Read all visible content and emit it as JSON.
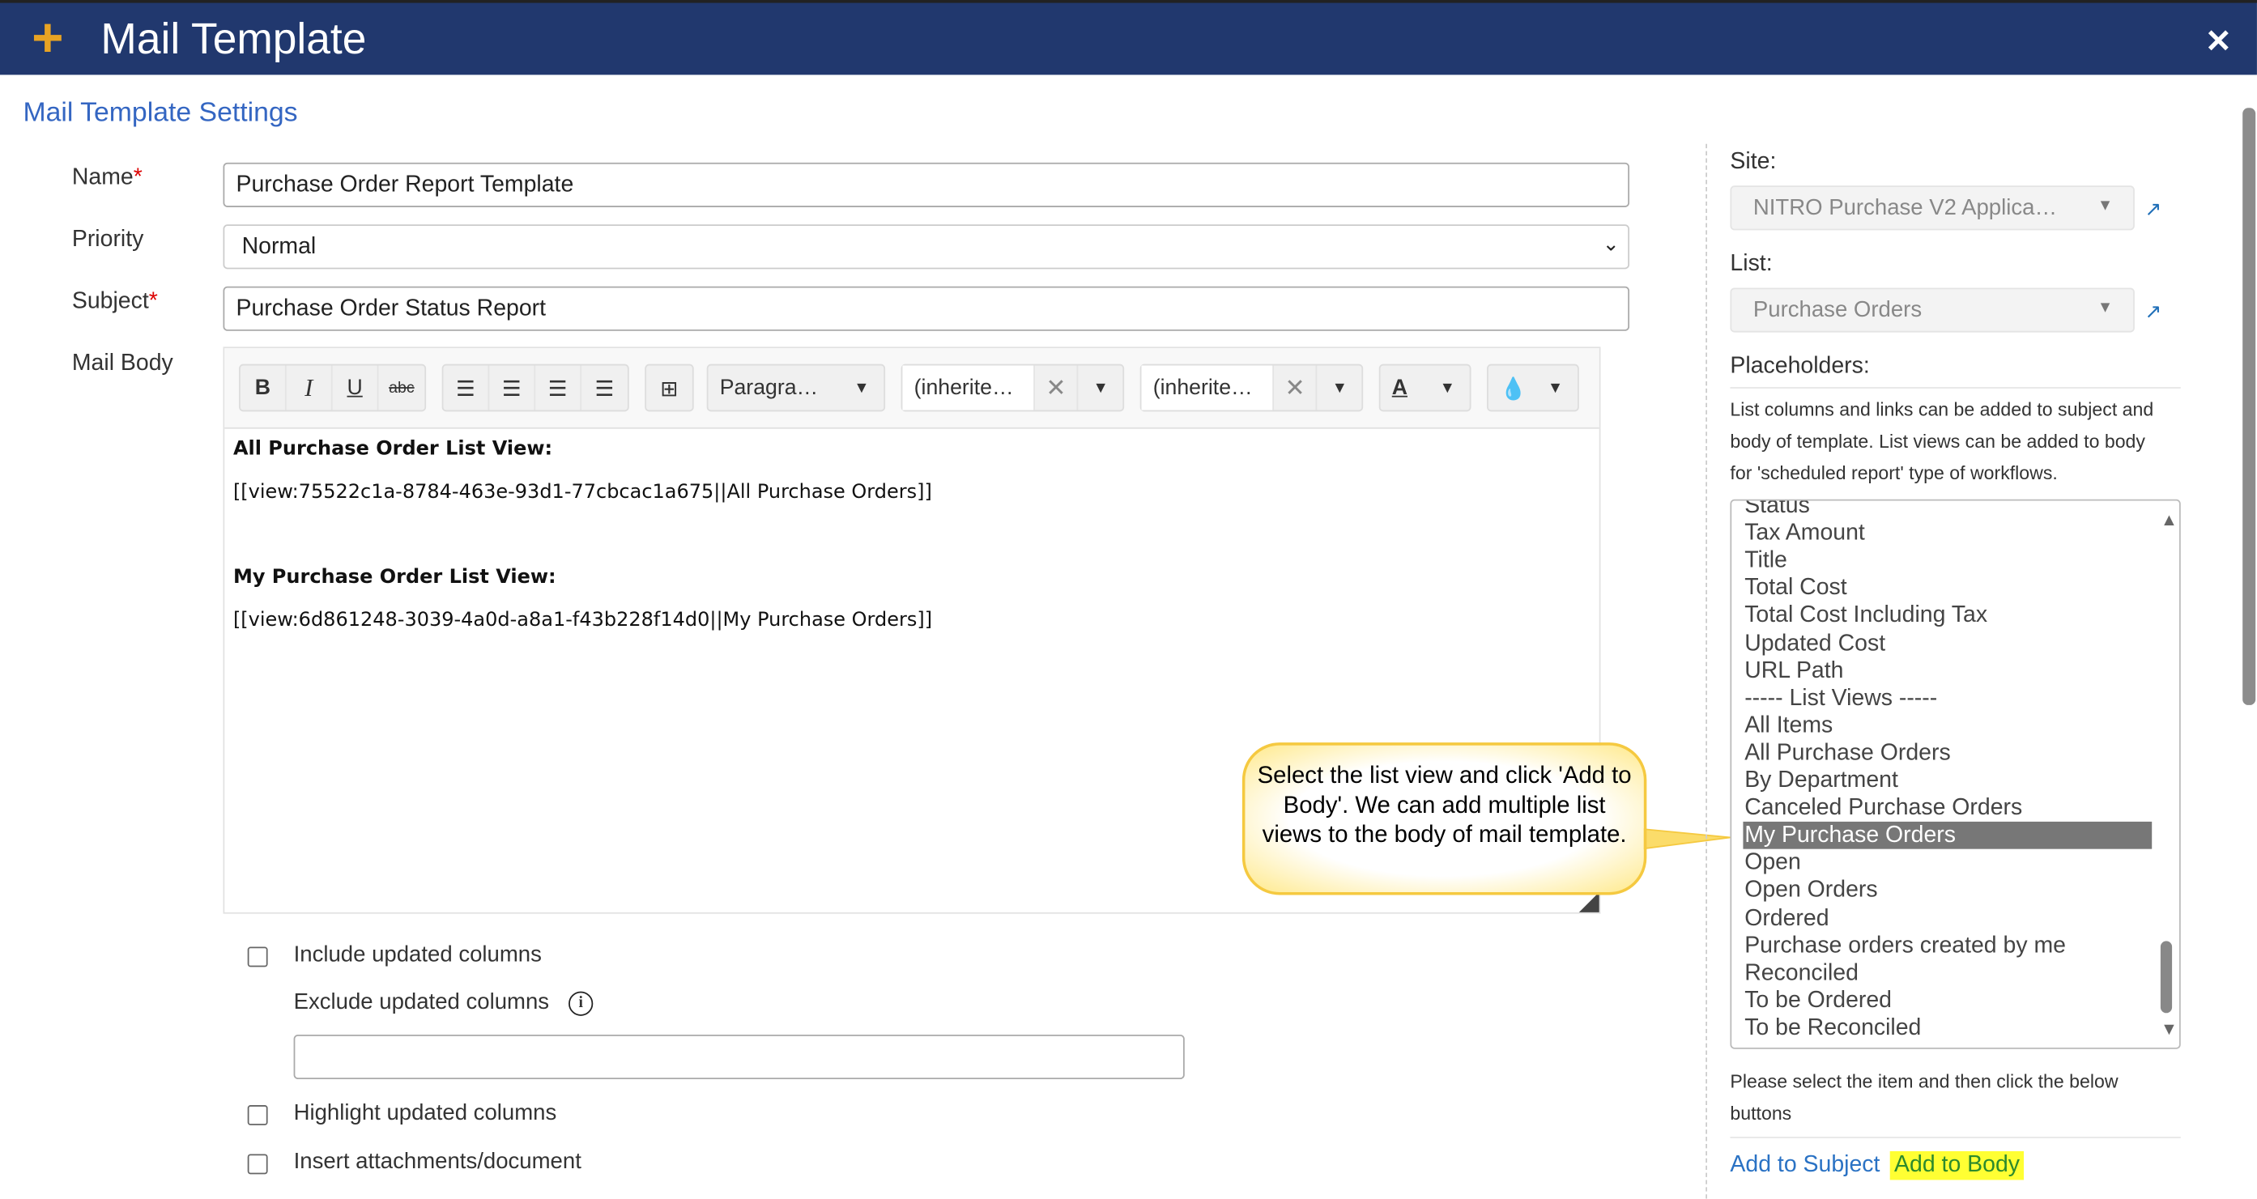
{
  "header": {
    "title": "Mail Template",
    "icon": "plus-icon",
    "close_icon": "close-icon",
    "accent": "#e8a323",
    "bg": "#21386e"
  },
  "section_title": "Mail Template Settings",
  "form": {
    "name_label": "Name",
    "name_value": "Purchase Order Report Template",
    "priority_label": "Priority",
    "priority_value": "Normal",
    "subject_label": "Subject",
    "subject_value": "Purchase Order Status Report",
    "body_label": "Mail Body"
  },
  "toolbar": {
    "bold": "B",
    "italic": "I",
    "underline": "U",
    "strike": "abc",
    "format": "Paragra…",
    "font_family": "(inherite…",
    "font_size": "(inherite…",
    "text_color": "A"
  },
  "body": {
    "heading1": "All Purchase Order List View:",
    "line1": "[[view:75522c1a-8784-463e-93d1-77cbcac1a675||All Purchase Orders]]",
    "heading2": "My Purchase Order List View:",
    "line2": "[[view:6d861248-3039-4a0d-a8a1-f43b228f14d0||My Purchase Orders]]"
  },
  "callout": "Select the list view and click 'Add to Body'. We can add multiple list views to the body of mail template.",
  "options": {
    "include_updated": "Include updated columns",
    "exclude_updated": "Exclude updated columns",
    "exclude_value": "",
    "highlight_updated": "Highlight updated columns",
    "insert_attachments": "Insert attachments/document"
  },
  "right": {
    "site_label": "Site:",
    "site_value": "NITRO Purchase V2 Applica…",
    "list_label": "List:",
    "list_value": "Purchase Orders",
    "placeholders_label": "Placeholders:",
    "help1": "List columns and links can be added to subject and",
    "help2": "body of template. List views can be added to body",
    "help3": "for 'scheduled report' type of workflows.",
    "items": [
      "Status",
      "Tax Amount",
      "Title",
      "Total Cost",
      "Total Cost Including Tax",
      "Updated Cost",
      "URL Path",
      "----- List Views -----",
      "All Items",
      "All Purchase Orders",
      "By Department",
      "Canceled Purchase Orders",
      "My Purchase Orders",
      "Open",
      "Open Orders",
      "Ordered",
      "Purchase orders created by me",
      "Reconciled",
      "To be Ordered",
      "To be Reconciled"
    ],
    "selected": "My Purchase Orders",
    "note1": "Please select the item and then click the below",
    "note2": "buttons",
    "add_subject": "Add to Subject",
    "add_body": "Add to Body"
  }
}
